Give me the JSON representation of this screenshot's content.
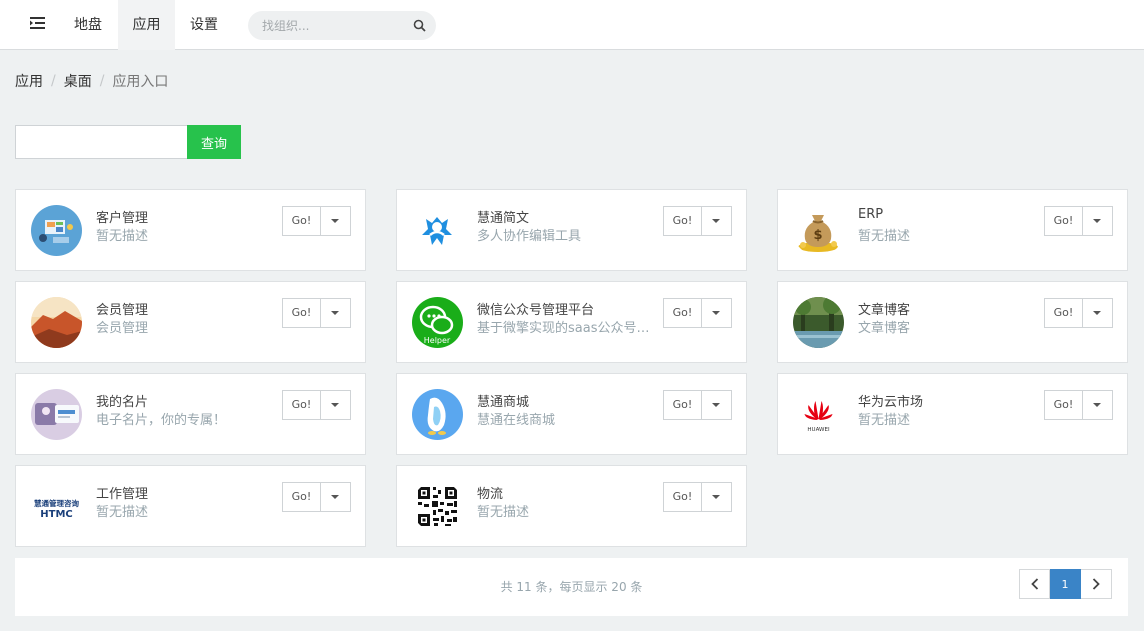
{
  "nav": {
    "items": [
      "地盘",
      "应用",
      "设置"
    ],
    "active": "应用",
    "search_placeholder": "找组织..."
  },
  "breadcrumb": [
    "应用",
    "桌面",
    "应用入口"
  ],
  "query": {
    "button_label": "查询",
    "value": ""
  },
  "apps": [
    {
      "name": "客户管理",
      "desc": "暂无描述",
      "icon": "customer-management-icon"
    },
    {
      "name": "慧通简文",
      "desc": "多人协作编辑工具",
      "icon": "huitong-jianwen-icon"
    },
    {
      "name": "ERP",
      "desc": "暂无描述",
      "icon": "money-bag-icon"
    },
    {
      "name": "会员管理",
      "desc": "会员管理",
      "icon": "member-management-icon"
    },
    {
      "name": "微信公众号管理平台",
      "desc": "基于微擎实现的saas公众号管理平台",
      "icon": "wechat-helper-icon"
    },
    {
      "name": "文章博客",
      "desc": "文章博客",
      "icon": "article-blog-icon"
    },
    {
      "name": "我的名片",
      "desc": "电子名片，你的专属！",
      "icon": "business-card-icon"
    },
    {
      "name": "慧通商城",
      "desc": "慧通在线商城",
      "icon": "huitong-mall-icon"
    },
    {
      "name": "华为云市场",
      "desc": "暂无描述",
      "icon": "huawei-icon"
    },
    {
      "name": "工作管理",
      "desc": "暂无描述",
      "icon": "htmc-logo-icon"
    },
    {
      "name": "物流",
      "desc": "暂无描述",
      "icon": "qr-code-icon"
    }
  ],
  "go_label": "Go!",
  "icon_texts": {
    "wechat": "Helper",
    "huawei": "HUAWEI",
    "htmc_top": "慧通管理咨询",
    "htmc_bottom": "HTMC"
  },
  "footer": {
    "count_text": "共 11 条，每页显示 20 条",
    "current_page": "1"
  },
  "colors": {
    "accent_green": "#27c24c",
    "page_active": "#3a84c7",
    "huawei_red": "#e60012",
    "wechat_green": "#1aad19"
  }
}
